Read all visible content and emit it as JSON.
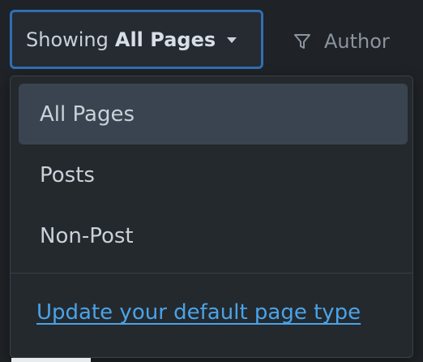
{
  "toolbar": {
    "filter": {
      "prefix": "Showing",
      "value": "All Pages"
    },
    "author": {
      "label": "Author",
      "icon": "funnel-icon"
    }
  },
  "dropdown": {
    "items": [
      {
        "label": "All Pages",
        "selected": true
      },
      {
        "label": "Posts",
        "selected": false
      },
      {
        "label": "Non-Post",
        "selected": false
      }
    ],
    "footer_link": "Update your default page type"
  },
  "colors": {
    "background": "#1f2226",
    "menu_background": "#24292e",
    "selected_item": "#3a4450",
    "focus_border": "#2f6fb3",
    "link": "#4aa3e8",
    "text": "#c9d1d9",
    "muted_text": "#8b949e"
  }
}
